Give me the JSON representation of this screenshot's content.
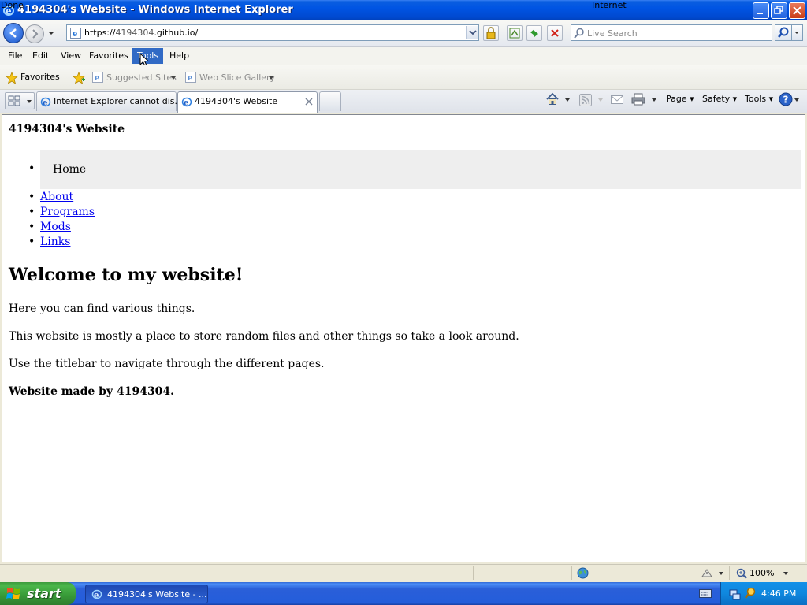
{
  "window": {
    "title": "4194304's Website - Windows Internet Explorer"
  },
  "navigation": {
    "url_prefix": "https://",
    "url_host": "4194304",
    "url_domain": ".github.io/",
    "search_placeholder": "Live Search"
  },
  "menu": {
    "items": [
      "File",
      "Edit",
      "View",
      "Favorites",
      "Tools",
      "Help"
    ],
    "active": "Tools"
  },
  "favorites_bar": {
    "favorites_label": "Favorites",
    "suggested_sites": "Suggested Sites",
    "web_slice_gallery": "Web Slice Gallery"
  },
  "tabs": [
    {
      "label": "Internet Explorer cannot dis..."
    },
    {
      "label": "4194304's Website"
    }
  ],
  "command_bar": {
    "page": "Page",
    "safety": "Safety",
    "tools": "Tools"
  },
  "page": {
    "site_title": "4194304's Website",
    "nav": {
      "home": "Home",
      "links": [
        "About",
        "Programs",
        "Mods",
        "Links"
      ]
    },
    "heading": "Welcome to my website!",
    "paragraphs": [
      "Here you can find various things.",
      "This website is mostly a place to store random files and other things so take a look around.",
      "Use the titlebar to navigate through the different pages."
    ],
    "footer": "Website made by 4194304."
  },
  "status": {
    "text": "Done",
    "zone": "Internet",
    "zoom": "100%"
  },
  "taskbar": {
    "start_label": "start",
    "task_label": "4194304's Website - ...",
    "clock": "4:46 PM"
  },
  "colors": {
    "titlebar": "#0054e3",
    "link": "#0000ee",
    "menu_highlight": "#316ac5",
    "home_band": "#eeeeee",
    "start_button": "#3c9a3c"
  }
}
